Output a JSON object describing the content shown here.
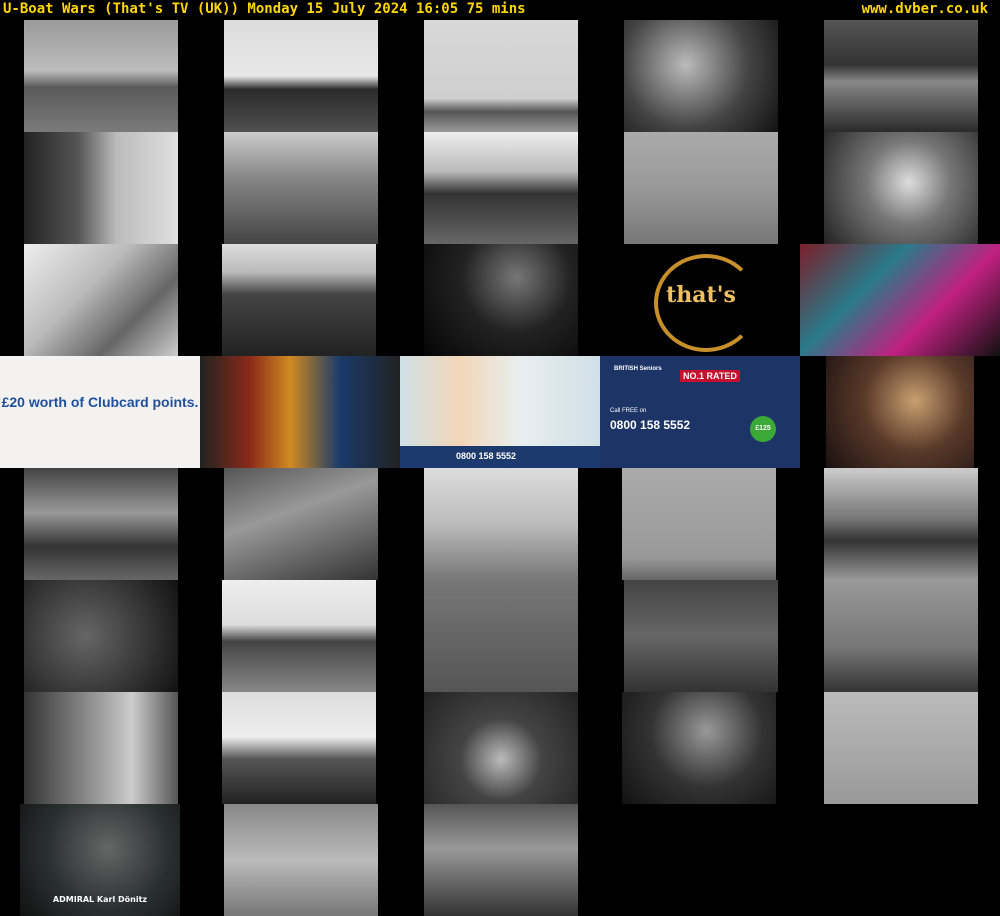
{
  "header": {
    "title": "U-Boat Wars (That's TV (UK))    Monday 15 July 2024  16:05  75 mins",
    "site": "www.dvber.co.uk"
  },
  "ads": {
    "clubcard_headline": "£20 worth of Clubcard points.",
    "bt_rated": "NO.1 RATED",
    "bt_free": "Call FREE on",
    "bt_phone": "0800 158 5552",
    "bt_badge": "£125",
    "bt_logo": "BRITISH Seniors",
    "sf_phone": "0800 158 5552",
    "channel_logo": "that's",
    "caption": "ADMIRAL Karl Dönitz"
  },
  "colors": {
    "header_text": "#ffd700",
    "background": "#000000"
  }
}
